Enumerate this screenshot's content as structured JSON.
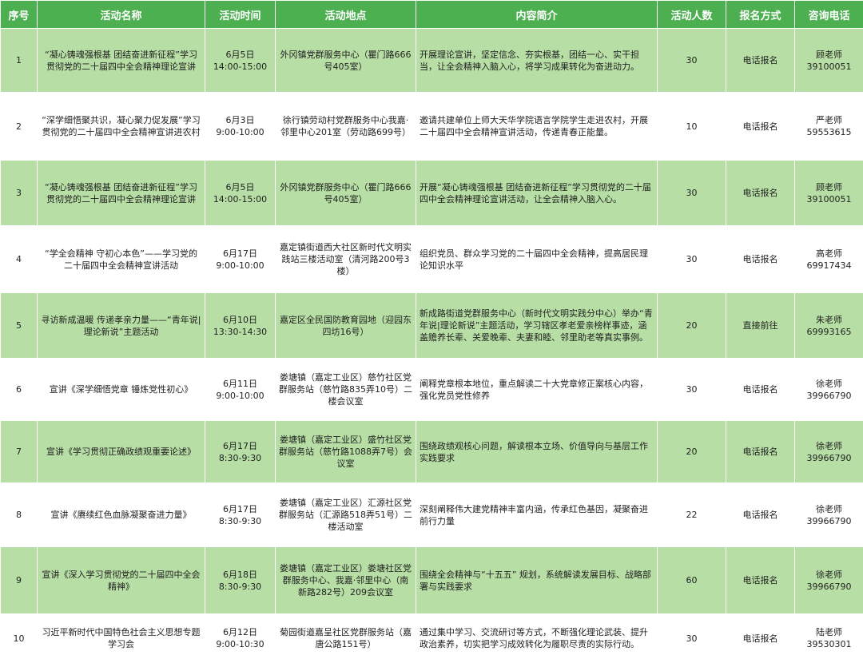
{
  "headers": [
    "序号",
    "活动名称",
    "活动时间",
    "活动地点",
    "内容简介",
    "活动人数",
    "报名方式",
    "咨询电话"
  ],
  "rows": [
    {
      "no": "1",
      "name": "“凝心铸魂强根基 团结奋进新征程”学习贯彻党的二十届四中全会精神理论宣讲",
      "date": "6月5日",
      "time": "14:00-15:00",
      "location": "外冈镇党群服务中心（瞿门路666号405室）",
      "desc": "开展理论宣讲，坚定信念、夯实根基，团结一心、实干担当，让全会精神入脑入心，将学习成果转化为奋进动力。",
      "count": "30",
      "signup": "电话报名",
      "contact": "顾老师",
      "phone": "39100051"
    },
    {
      "no": "2",
      "name": "“深学细悟聚共识，凝心聚力促发展”学习贯彻党的二十届四中全会精神宣讲进农村",
      "date": "6月3日",
      "time": "9:00-10:00",
      "location": "徐行镇劳动村党群服务中心我嘉·邻里中心201室（劳动路699号）",
      "desc": "邀请共建单位上师大天华学院语言学院学生走进农村，开展二十届四中全会精神宣讲活动，传递青春正能量。",
      "count": "10",
      "signup": "电话报名",
      "contact": "严老师",
      "phone": "59553615"
    },
    {
      "no": "3",
      "name": "“凝心铸魂强根基 团结奋进新征程”学习贯彻党的二十届四中全会精神理论宣讲",
      "date": "6月5日",
      "time": "14:00-15:00",
      "location": "外冈镇党群服务中心（瞿门路666号405室）",
      "desc": "开展“凝心铸魂强根基 团结奋进新征程”学习贯彻党的二十届四中全会精神理论宣讲活动，让全会精神入脑入心。",
      "count": "30",
      "signup": "电话报名",
      "contact": "顾老师",
      "phone": "39100051"
    },
    {
      "no": "4",
      "name": "“学全会精神 守初心本色”——学习党的二十届四中全会精神宣讲活动",
      "date": "6月17日",
      "time": "9:00-10:00",
      "location": "嘉定镇街道西大社区新时代文明实践站三楼活动室（清河路200号3楼）",
      "desc": "组织党员、群众学习党的二十届四中全会精神，提高居民理论知识水平",
      "count": "30",
      "signup": "电话报名",
      "contact": "高老师",
      "phone": "69917434"
    },
    {
      "no": "5",
      "name": "寻访新成温暖 传递孝亲力量——“青年说|理论新说”主题活动",
      "date": "6月10日",
      "time": "13:30-14:30",
      "location": "嘉定区全民国防教育园地（迎园东四坊16号）",
      "desc": "新成路街道党群服务中心（新时代文明实践分中心）举办“青年说|理论新说”主题活动，学习辖区孝老爱亲榜样事迹，涵盖赡养长辈、关爱晚辈、夫妻和睦、邻里助老等真实事例。",
      "count": "20",
      "signup": "直接前往",
      "contact": "朱老师",
      "phone": "69993165"
    },
    {
      "no": "6",
      "name": "宣讲《深学细悟党章 锤炼党性初心》",
      "date": "6月11日",
      "time": "9:00-10:00",
      "location": "娄塘镇（嘉定工业区）慈竹社区党群服务站（慈竹路835弄10号）二楼会议室",
      "desc": "阐释党章根本地位，重点解读二十大党章修正案核心内容，强化党员党性修养",
      "count": "30",
      "signup": "电话报名",
      "contact": "徐老师",
      "phone": "39966790"
    },
    {
      "no": "7",
      "name": "宣讲《学习贯彻正确政绩观重要论述》",
      "date": "6月17日",
      "time": "8:30-9:30",
      "location": "娄塘镇（嘉定工业区）盛竹社区党群服务站（慈竹路1088弄7号）会议室",
      "desc": "围绕政绩观核心问题，解读根本立场、价值导向与基层工作实践要求",
      "count": "20",
      "signup": "电话报名",
      "contact": "徐老师",
      "phone": "39966790"
    },
    {
      "no": "8",
      "name": "宣讲《赓续红色血脉凝聚奋进力量》",
      "date": "6月17日",
      "time": "8:30-9:30",
      "location": "娄塘镇（嘉定工业区）汇源社区党群服务站（汇源路518弄51号）二楼活动室",
      "desc": "深刻阐释伟大建党精神丰富内涵，传承红色基因，凝聚奋进前行力量",
      "count": "22",
      "signup": "电话报名",
      "contact": "徐老师",
      "phone": "39966790"
    },
    {
      "no": "9",
      "name": "宣讲《深入学习贯彻党的二十届四中全会精神》",
      "date": "6月18日",
      "time": "8:30-9:30",
      "location": "娄塘镇（嘉定工业区）娄塘社区党群服务中心、我嘉·邻里中心（南新路282号）209会议室",
      "desc": "围绕全会精神与“十五五” 规划，系统解读发展目标、战略部署与实践要求",
      "count": "60",
      "signup": "电话报名",
      "contact": "徐老师",
      "phone": "39966790"
    },
    {
      "no": "10",
      "name": "习近平新时代中国特色社会主义思想专题学习会",
      "date": "6月12日",
      "time": "9:00-10:30",
      "location": "菊园街道嘉呈社区党群服务站（嘉唐公路151号）",
      "desc": "通过集中学习、交流研讨等方式，不断强化理论武装、提升政治素养，切实把学习成效转化为履职尽责的实际行动。",
      "count": "30",
      "signup": "电话报名",
      "contact": "陆老师",
      "phone": "39530301"
    }
  ],
  "colors": {
    "header_bg": "#4caf50",
    "stripe": "#b7dea4",
    "header_text": "#ffffff"
  }
}
